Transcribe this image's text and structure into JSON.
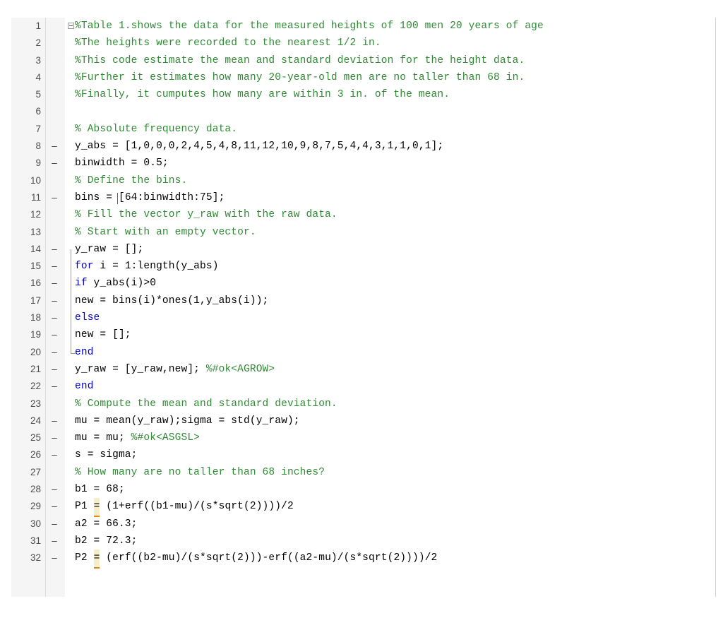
{
  "editor": {
    "name": "matlab-code-editor",
    "language": "MATLAB",
    "colors": {
      "background": "#ffffff",
      "gutter_background": "#f5f5f5",
      "comment": "#2f8a33",
      "keyword": "#0000c8",
      "code": "#000000",
      "warning_highlight": "#f5eec8",
      "warning_underline": "#e08a1a"
    },
    "lines": [
      {
        "number": "1",
        "executable": "",
        "segments": [
          {
            "kind": "comment",
            "text": "%Table 1.shows the data for the measured heights of 100 men 20 years of age"
          }
        ]
      },
      {
        "number": "2",
        "executable": "",
        "segments": [
          {
            "kind": "comment",
            "text": "%The heights were recorded to the nearest 1/2 in."
          }
        ]
      },
      {
        "number": "3",
        "executable": "",
        "segments": [
          {
            "kind": "comment",
            "text": "%This code estimate the mean and standard deviation for the height data."
          }
        ]
      },
      {
        "number": "4",
        "executable": "",
        "segments": [
          {
            "kind": "comment",
            "text": "%Further it estimates how many 20-year-old men are no taller than 68 in."
          }
        ]
      },
      {
        "number": "5",
        "executable": "",
        "segments": [
          {
            "kind": "comment",
            "text": "%Finally, it cumputes how many are within 3 in. of the mean."
          }
        ]
      },
      {
        "number": "6",
        "executable": "",
        "segments": []
      },
      {
        "number": "7",
        "executable": "",
        "segments": [
          {
            "kind": "comment",
            "text": "% Absolute frequency data."
          }
        ]
      },
      {
        "number": "8",
        "executable": "–",
        "segments": [
          {
            "kind": "code",
            "text": "y_abs = [1,0,0,0,2,4,5,4,8,11,12,10,9,8,7,5,4,4,3,1,1,0,1];"
          }
        ]
      },
      {
        "number": "9",
        "executable": "–",
        "segments": [
          {
            "kind": "code",
            "text": "binwidth = 0.5;"
          }
        ]
      },
      {
        "number": "10",
        "executable": "",
        "segments": [
          {
            "kind": "comment",
            "text": "% Define the bins."
          }
        ]
      },
      {
        "number": "11",
        "executable": "–",
        "segments": [
          {
            "kind": "code",
            "text": "bins = "
          },
          {
            "kind": "caret",
            "text": ""
          },
          {
            "kind": "code",
            "text": "[64:binwidth:75];"
          }
        ]
      },
      {
        "number": "12",
        "executable": "",
        "segments": [
          {
            "kind": "comment",
            "text": "% Fill the vector y_raw with the raw data."
          }
        ]
      },
      {
        "number": "13",
        "executable": "",
        "segments": [
          {
            "kind": "comment",
            "text": "% Start with an empty vector."
          }
        ]
      },
      {
        "number": "14",
        "executable": "–",
        "segments": [
          {
            "kind": "code",
            "text": "y_raw = [];"
          }
        ]
      },
      {
        "number": "15",
        "executable": "–",
        "segments": [
          {
            "kind": "keyword",
            "text": "for"
          },
          {
            "kind": "code",
            "text": " i = 1:length(y_abs)"
          }
        ]
      },
      {
        "number": "16",
        "executable": "–",
        "segments": [
          {
            "kind": "keyword",
            "text": "if"
          },
          {
            "kind": "code",
            "text": " y_abs(i)>0"
          }
        ]
      },
      {
        "number": "17",
        "executable": "–",
        "segments": [
          {
            "kind": "code",
            "text": "new = bins(i)*ones(1,y_abs(i));"
          }
        ]
      },
      {
        "number": "18",
        "executable": "–",
        "segments": [
          {
            "kind": "keyword",
            "text": "else"
          }
        ]
      },
      {
        "number": "19",
        "executable": "–",
        "segments": [
          {
            "kind": "code",
            "text": "new = [];"
          }
        ]
      },
      {
        "number": "20",
        "executable": "–",
        "segments": [
          {
            "kind": "keyword",
            "text": "end"
          }
        ]
      },
      {
        "number": "21",
        "executable": "–",
        "segments": [
          {
            "kind": "code",
            "text": "y_raw = [y_raw,new]; "
          },
          {
            "kind": "comment",
            "text": "%#ok<AGROW>"
          }
        ]
      },
      {
        "number": "22",
        "executable": "–",
        "segments": [
          {
            "kind": "keyword",
            "text": "end"
          }
        ]
      },
      {
        "number": "23",
        "executable": "",
        "segments": [
          {
            "kind": "comment",
            "text": "% Compute the mean and standard deviation."
          }
        ]
      },
      {
        "number": "24",
        "executable": "–",
        "segments": [
          {
            "kind": "code",
            "text": "mu = mean(y_raw);sigma = std(y_raw);"
          }
        ]
      },
      {
        "number": "25",
        "executable": "–",
        "segments": [
          {
            "kind": "code",
            "text": "mu = mu; "
          },
          {
            "kind": "comment",
            "text": "%#ok<ASGSL>"
          }
        ]
      },
      {
        "number": "26",
        "executable": "–",
        "segments": [
          {
            "kind": "code",
            "text": "s = sigma;"
          }
        ]
      },
      {
        "number": "27",
        "executable": "",
        "segments": [
          {
            "kind": "comment",
            "text": "% How many are no taller than 68 inches?"
          }
        ]
      },
      {
        "number": "28",
        "executable": "–",
        "segments": [
          {
            "kind": "code",
            "text": "b1 = 68;"
          }
        ]
      },
      {
        "number": "29",
        "executable": "–",
        "segments": [
          {
            "kind": "code",
            "text": "P1 "
          },
          {
            "kind": "warn",
            "text": "="
          },
          {
            "kind": "code",
            "text": " (1+erf((b1-mu)/(s*sqrt(2))))/2"
          }
        ]
      },
      {
        "number": "30",
        "executable": "–",
        "segments": [
          {
            "kind": "code",
            "text": "a2 = 66.3;"
          }
        ]
      },
      {
        "number": "31",
        "executable": "–",
        "segments": [
          {
            "kind": "code",
            "text": "b2 = 72.3;"
          }
        ]
      },
      {
        "number": "32",
        "executable": "–",
        "segments": [
          {
            "kind": "code",
            "text": "P2 "
          },
          {
            "kind": "warn",
            "text": "="
          },
          {
            "kind": "code",
            "text": " (erf((b2-mu)/(s*sqrt(2)))-erf((a2-mu)/(s*sqrt(2))))/2"
          }
        ]
      }
    ]
  }
}
